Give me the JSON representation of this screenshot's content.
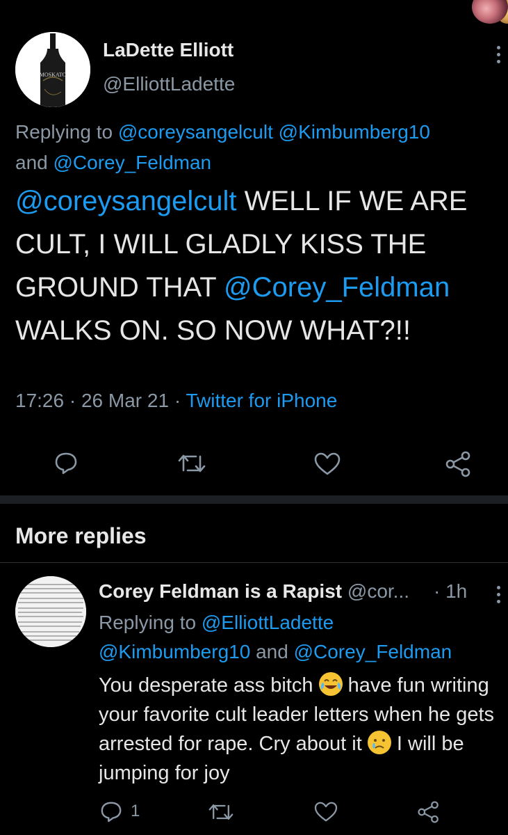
{
  "main_tweet": {
    "author_name": "LaDette Elliott",
    "author_handle": "@ElliottLadette",
    "avatar_label": "MOSKATO",
    "replying_prefix": "Replying to ",
    "replying_to_1": "@coreysangelcult",
    "replying_to_2": "@Kimbumberg10",
    "replying_and": "and ",
    "replying_to_3": "@Corey_Feldman",
    "text_mention_1": "@coreysangelcult",
    "text_part_1": " WELL IF WE ARE CULT, I WILL GLADLY KISS THE GROUND THAT ",
    "text_mention_2": "@Corey_Feldman",
    "text_part_2": " WALKS ON. SO NOW WHAT?!!",
    "time": "17:26",
    "date": "26 Mar 21",
    "source": "Twitter for iPhone",
    "actions": [
      "reply-icon",
      "retweet-icon",
      "like-icon",
      "share-icon"
    ]
  },
  "section": {
    "more_replies": "More replies"
  },
  "reply_tweet": {
    "author_name": "Corey Feldman is a Rapist",
    "author_handle": "@cor...",
    "time": "· 1h",
    "replying_prefix": "Replying to ",
    "replying_to_1": "@ElliottLadette",
    "replying_to_2": "@Kimbumberg10",
    "replying_and": " and ",
    "replying_to_3": "@Corey_Feldman",
    "text_part_1": "You desperate ass bitch ",
    "text_part_2": " have fun writing your favorite cult leader letters when he gets arrested for rape. Cry about it ",
    "text_part_3": " I will be jumping for joy",
    "emoji_1": "face-with-tears-of-joy",
    "emoji_2": "crying-face",
    "reply_count": "1"
  },
  "colors": {
    "background": "#000000",
    "link": "#1d9bf0",
    "secondary": "#8b98a5",
    "divider": "#1c1f23"
  }
}
